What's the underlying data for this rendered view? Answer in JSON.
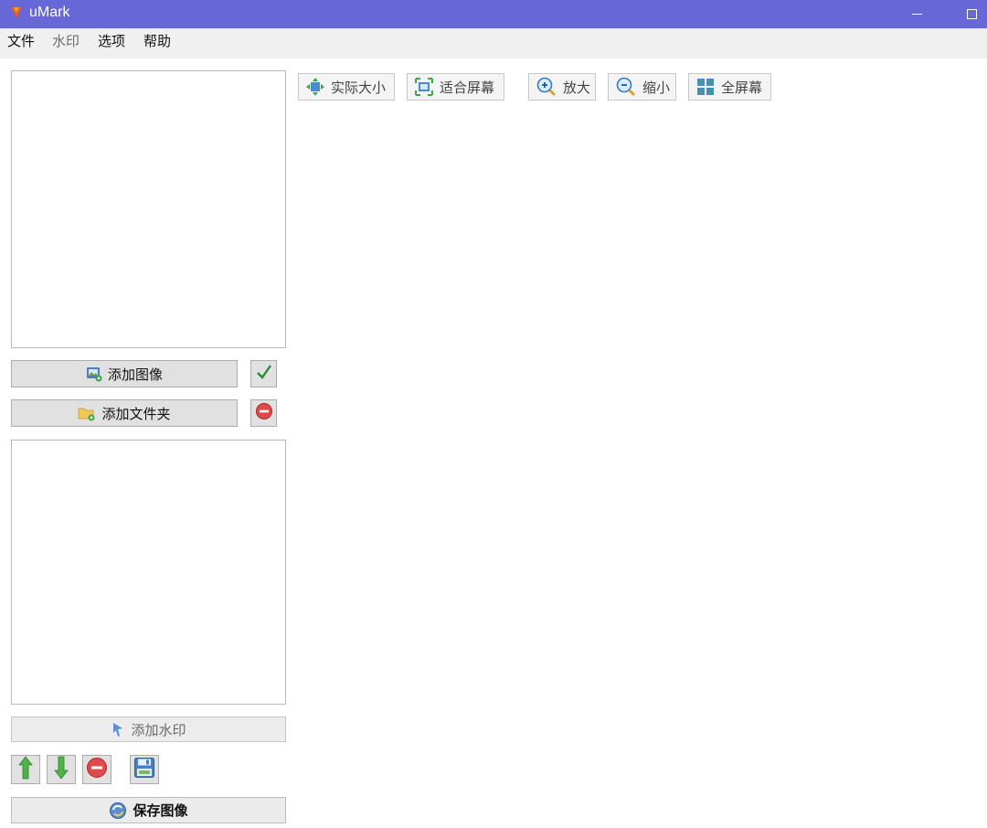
{
  "window": {
    "title": "uMark",
    "minimize_symbol": "─",
    "maximize_symbol": "□"
  },
  "menu": {
    "items": [
      {
        "label": "文件"
      },
      {
        "label": "水印"
      },
      {
        "label": "选项"
      },
      {
        "label": "帮助"
      }
    ]
  },
  "image_panel": {
    "add_image_label": "添加图像",
    "add_folder_label": "添加文件夹"
  },
  "watermark_panel": {
    "add_watermark_label": "添加水印",
    "save_image_label": "保存图像"
  },
  "toolbar": {
    "actual_size_label": "实际大小",
    "fit_screen_label": "适合屏幕",
    "zoom_in_label": "放大",
    "zoom_out_label": "缩小",
    "fullscreen_label": "全屏幕"
  },
  "icons": {
    "app": "umark-logo-icon",
    "add_image": "add-image-icon",
    "add_folder": "add-folder-icon",
    "confirm": "check-icon",
    "remove_image": "remove-icon",
    "add_watermark": "watermark-pin-icon",
    "move_up": "arrow-up-icon",
    "move_down": "arrow-down-icon",
    "remove_watermark": "remove-icon",
    "save_template": "floppy-disk-icon",
    "save_image": "save-image-icon"
  },
  "colors": {
    "titlebar": "#6867d8",
    "menubar": "#f0f0f0",
    "button_face": "#e1e1e1"
  }
}
